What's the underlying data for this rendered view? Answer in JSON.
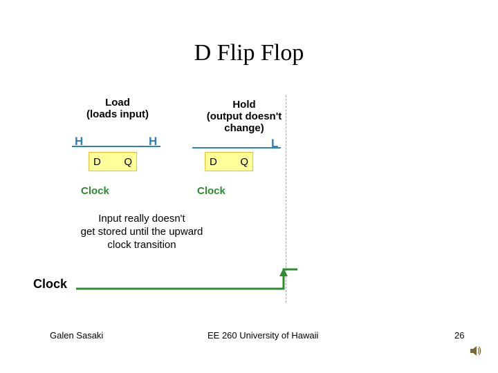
{
  "title": "D Flip Flop",
  "labels": {
    "load_top": "Load",
    "load_sub": "(loads input)",
    "hold_top": "Hold",
    "hold_sub1": "(output doesn't",
    "hold_sub2": "change)",
    "H1": "H",
    "H2": "H",
    "L1": "L",
    "D1": "D",
    "Q1": "Q",
    "D2": "D",
    "Q2": "Q",
    "clock1": "Clock",
    "clock2": "Clock",
    "clock_big": "Clock",
    "note_l1": "Input really doesn't",
    "note_l2": "get stored until the upward",
    "note_l3": "clock transition"
  },
  "footer": {
    "left": "Galen Sasaki",
    "center": "EE 260 University of Hawaii",
    "right": "26"
  }
}
